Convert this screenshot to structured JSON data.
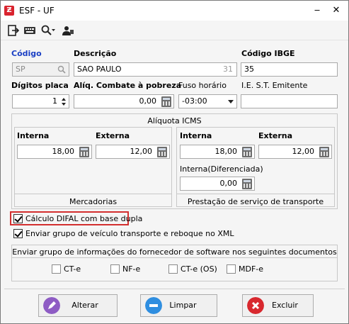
{
  "window": {
    "title": "ESF - UF",
    "app_icon_glyph": "Ƶ",
    "minimize": "‒",
    "close": "✕"
  },
  "toolbar": {
    "icons": [
      "exit-icon",
      "keyboard-icon",
      "search-icon",
      "user-icon"
    ]
  },
  "fields": {
    "codigo_label": "Código",
    "codigo_value": "SP",
    "descricao_label": "Descrição",
    "descricao_value": "SAO PAULO",
    "descricao_count": "31",
    "codigo_ibge_label": "Código IBGE",
    "codigo_ibge_value": "35",
    "digitos_placa_label": "Dígitos placa",
    "digitos_placa_value": "1",
    "aliq_pobreza_label": "Alíq. Combate à pobreza",
    "aliq_pobreza_value": "0,00",
    "fuso_label": "Fuso horário",
    "fuso_value": "-03:00",
    "ie_st_label": "I.E. S.T.  Emitente",
    "ie_st_value": ""
  },
  "aliquota": {
    "title": "Alíquota ICMS",
    "mercadorias": {
      "interna_label": "Interna",
      "interna_value": "18,00",
      "externa_label": "Externa",
      "externa_value": "12,00",
      "footer": "Mercadorias"
    },
    "transporte": {
      "interna_label": "Interna",
      "interna_value": "18,00",
      "externa_label": "Externa",
      "externa_value": "12,00",
      "diferenciada_label": "Interna(Diferenciada)",
      "diferenciada_value": "0,00",
      "footer": "Prestação de serviço de transporte"
    }
  },
  "options": {
    "difal_label": "Cálculo DIFAL com base dupla",
    "difal_checked": true,
    "veiculo_label": "Enviar grupo de veículo transporte e reboque no XML",
    "veiculo_checked": true
  },
  "fornecedor": {
    "title": "Enviar grupo de informações do fornecedor de software nos seguintes documentos",
    "docs": [
      "CT-e",
      "NF-e",
      "CT-e (OS)",
      "MDF-e"
    ]
  },
  "buttons": {
    "alterar": "Alterar",
    "limpar": "Limpar",
    "excluir": "Excluir"
  },
  "colors": {
    "highlight": "#d32f2f",
    "label_blue": "#1a3fc4",
    "alterar": "#8e5cc4",
    "limpar": "#2f8ee0",
    "excluir": "#d8282e"
  }
}
